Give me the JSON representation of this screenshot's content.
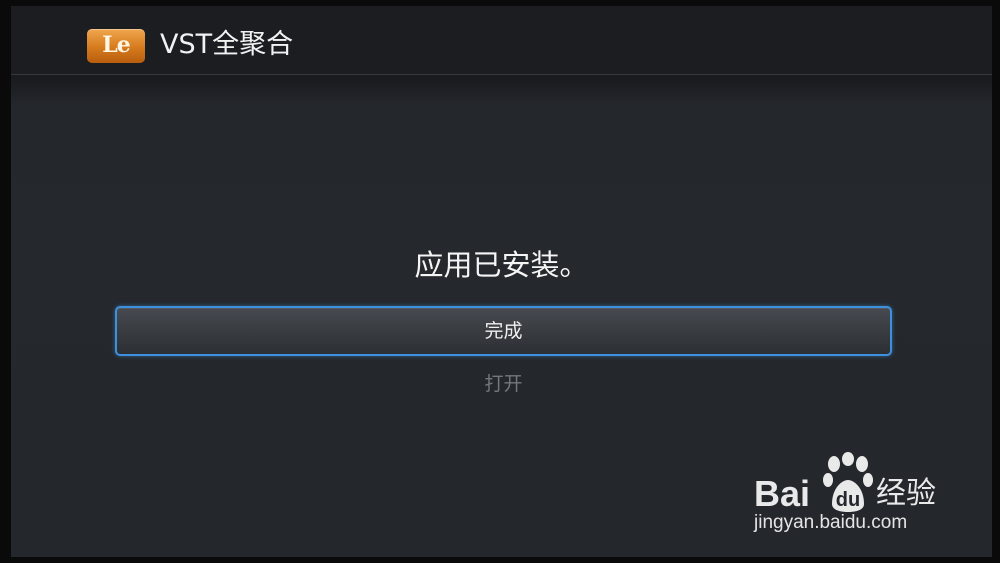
{
  "app": {
    "icon_text": "Le",
    "title": "VST全聚合"
  },
  "installer": {
    "message": "应用已安装。",
    "done_label": "完成",
    "open_label": "打开"
  },
  "watermark": {
    "brand_latin": "Bai",
    "brand_cn": "经验",
    "url": "jingyan.baidu.com"
  },
  "colors": {
    "focus_border": "#3f8fdf",
    "icon_orange": "#d67a1d",
    "disabled_text": "#74777c"
  }
}
